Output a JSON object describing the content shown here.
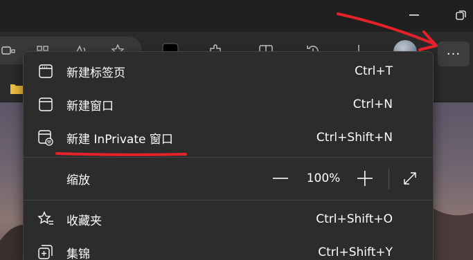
{
  "menu": {
    "items": [
      {
        "label": "新建标签页",
        "shortcut": "Ctrl+T",
        "icon": "new-tab-icon"
      },
      {
        "label": "新建窗口",
        "shortcut": "Ctrl+N",
        "icon": "new-window-icon"
      },
      {
        "label": "新建 InPrivate 窗口",
        "shortcut": "Ctrl+Shift+N",
        "icon": "inprivate-window-icon"
      }
    ],
    "zoom": {
      "label": "缩放",
      "value": "100%",
      "minus": "—",
      "plus": "+"
    },
    "items2": [
      {
        "label": "收藏夹",
        "shortcut": "Ctrl+Shift+O",
        "icon": "favorites-icon"
      },
      {
        "label": "集锦",
        "shortcut": "Ctrl+Shift+Y",
        "icon": "collections-icon"
      }
    ]
  },
  "toolbar": {
    "more_label": "···"
  },
  "colors": {
    "annotation_red": "#e5222a",
    "menu_bg": "#2c2c2c"
  }
}
